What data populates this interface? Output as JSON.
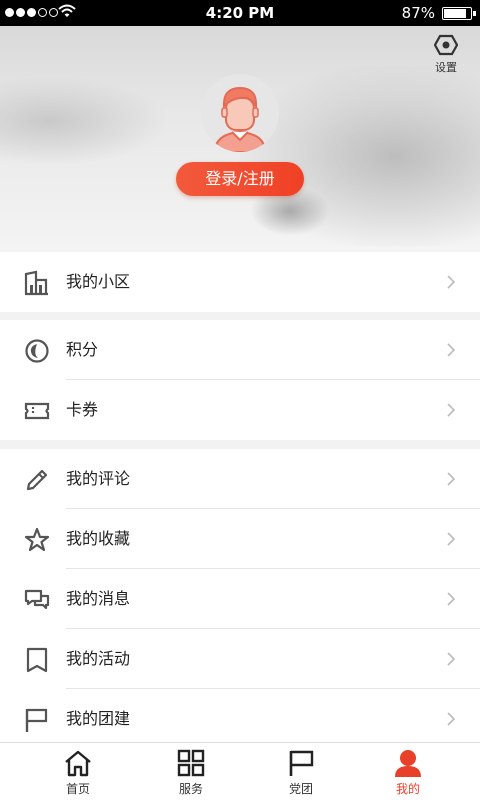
{
  "status_bar": {
    "time": "4:20 PM",
    "battery": "87%",
    "battery_level": 0.87
  },
  "header": {
    "settings_label": "设置",
    "login_label": "登录/注册"
  },
  "menu_groups": [
    [
      {
        "label": "我的小区",
        "icon": "building-icon"
      }
    ],
    [
      {
        "label": "积分",
        "icon": "points-coin-icon"
      },
      {
        "label": "卡券",
        "icon": "ticket-icon"
      }
    ],
    [
      {
        "label": "我的评论",
        "icon": "pencil-icon"
      },
      {
        "label": "我的收藏",
        "icon": "star-icon"
      },
      {
        "label": "我的消息",
        "icon": "chat-icon"
      },
      {
        "label": "我的活动",
        "icon": "bookmark-icon"
      },
      {
        "label": "我的团建",
        "icon": "flag-icon"
      }
    ]
  ],
  "tab_bar": [
    {
      "label": "首页",
      "icon": "home-icon"
    },
    {
      "label": "服务",
      "icon": "grid-icon"
    },
    {
      "label": "党团",
      "icon": "flag-icon"
    },
    {
      "label": "我的",
      "icon": "person-icon",
      "active": true
    }
  ],
  "colors": {
    "accent": "#e8412b",
    "icon": "#555555"
  }
}
